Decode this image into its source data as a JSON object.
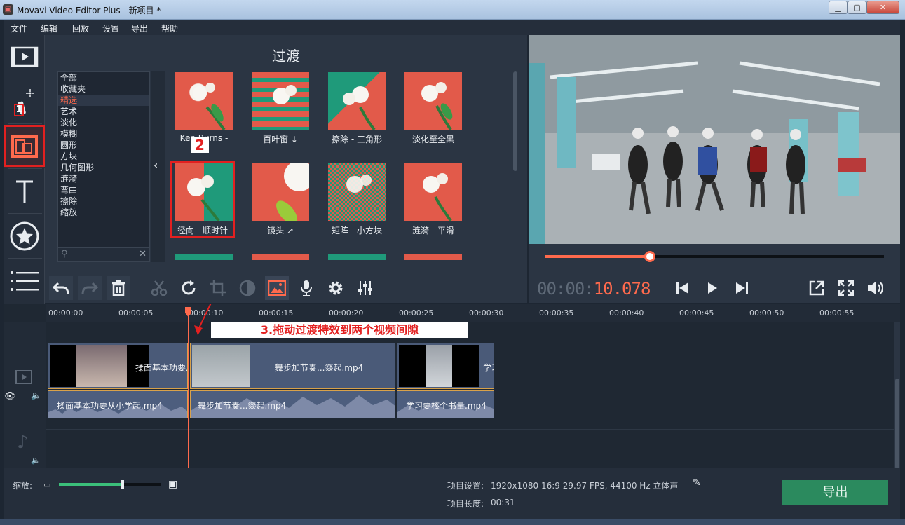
{
  "window": {
    "title": "Movavi Video Editor Plus - 新项目 *",
    "logo": "film-logo"
  },
  "menu": [
    "文件",
    "编辑",
    "回放",
    "设置",
    "导出",
    "帮助"
  ],
  "rail": {
    "annotation_1": "1"
  },
  "panel": {
    "title": "过渡",
    "categories": [
      "全部",
      "收藏夹",
      "精选",
      "艺术",
      "淡化",
      "模糊",
      "圆形",
      "方块",
      "几何图形",
      "涟漪",
      "弯曲",
      "擦除",
      "缩放"
    ],
    "selected_category": "精选",
    "tiles": [
      "Ken Burns - ",
      "百叶窗 ↓",
      "擦除 - 三角形",
      "淡化至全黑",
      "径向 - 顺时针",
      "镜头 ↗",
      "矩阵 - 小方块",
      "涟漪 - 平滑"
    ],
    "annotation_2": "2"
  },
  "player": {
    "timecode_prefix": "00:00:",
    "timecode_value": "10.078",
    "progress": 0.31
  },
  "timeline": {
    "ticks": [
      "00:00:00",
      "00:00:05",
      "00:00:10",
      "00:00:15",
      "00:00:20",
      "00:00:25",
      "00:00:30",
      "00:00:35",
      "00:00:40",
      "00:00:45",
      "00:00:50",
      "00:00:55"
    ],
    "annotation_3": "3.拖动过渡特效到两个视频间隙",
    "video_clips": [
      "揉面基本功要从小学起.mp4",
      "舞步加节奏...燚起.mp4",
      "学习要核个书量.mp4"
    ],
    "video_clip_labels": [
      "揉面基本功要从",
      "舞步加节奏...燚起.mp4",
      "学习"
    ],
    "audio_clips": [
      "揉面基本功要从小学起.mp4",
      "舞步加节奏...燚起.mp4",
      "学习要核个书量.mp4"
    ]
  },
  "footer": {
    "zoom_label": "缩放:",
    "zoom_level": 0.62,
    "settings_label": "项目设置:",
    "settings_value": "1920x1080 16:9 29.97 FPS, 44100 Hz 立体声",
    "length_label": "项目长度:",
    "length_value": "00:31",
    "export_label": "导出"
  },
  "colors": {
    "accent": "#ff6a4d",
    "highlight": "#e32020",
    "export": "#2b8a5e",
    "clip_border": "#d9a24a"
  }
}
